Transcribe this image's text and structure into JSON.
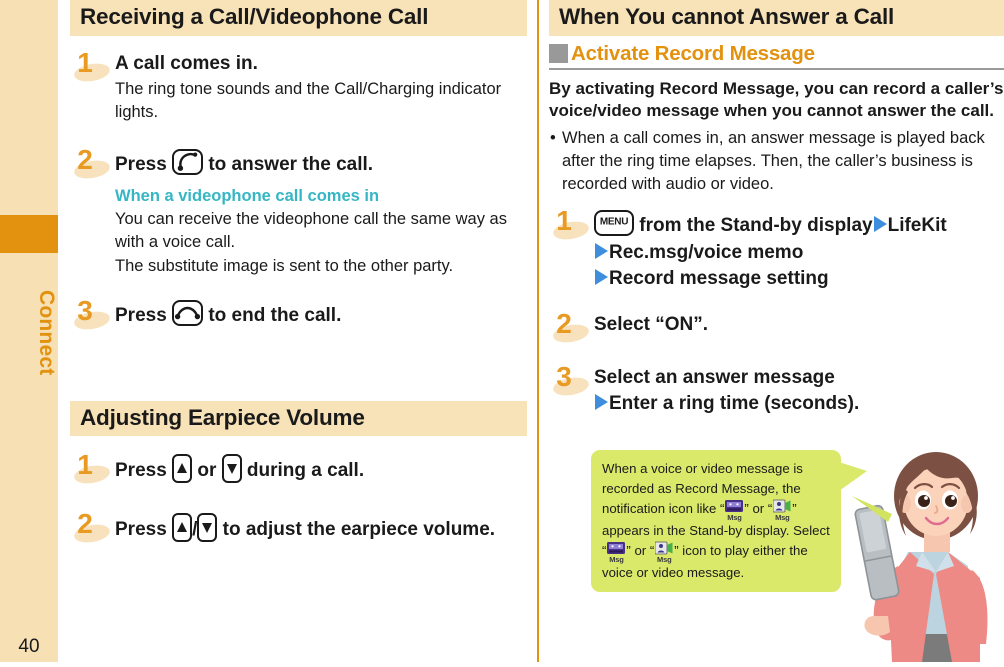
{
  "page": {
    "number": "40",
    "chapter_tab": "Connect",
    "accent_orange": "#e2920f",
    "band_beige": "#f8e2b8",
    "bubble_green": "#dbe96b",
    "teal": "#36b6c4",
    "arrow_blue": "#3f8ede"
  },
  "left_column": {
    "sections": [
      {
        "heading": "Receiving a Call/Videophone Call",
        "steps": [
          {
            "number": "1",
            "title_parts": [
              "A call comes in."
            ],
            "body": "The ring tone sounds and the Call/Charging indicator lights."
          },
          {
            "number": "2",
            "title_before": "Press",
            "key": "call-key",
            "title_after": "to answer the call.",
            "note_heading": "When a videophone call comes in",
            "body_line1": "You can receive the videophone call the same way as with a voice call.",
            "body_line2": "The substitute image is sent to the other party."
          },
          {
            "number": "3",
            "title_before": "Press",
            "key": "end-key",
            "title_after": "to end the call."
          }
        ]
      },
      {
        "heading": "Adjusting Earpiece Volume",
        "steps": [
          {
            "number": "1",
            "title_before": "Press",
            "key_up": "volume-up-key",
            "title_mid": "or",
            "key_down": "volume-down-key",
            "title_after": "during a call."
          },
          {
            "number": "2",
            "title_before": "Press",
            "key_up": "volume-up-key",
            "separator": "/",
            "key_down": "volume-down-key",
            "title_after": "to adjust the earpiece volume."
          }
        ]
      }
    ]
  },
  "right_column": {
    "heading": "When You cannot Answer a Call",
    "subheading": "Activate Record Message",
    "lead": "By activating Record Message, you can record a caller’s voice/video message when you cannot answer the call.",
    "bullets": [
      "When a call comes in, an answer message is played back after the ring time elapses. Then, the caller’s business is recorded with audio or video."
    ],
    "steps": [
      {
        "number": "1",
        "key": "menu-key",
        "key_label": "MENU",
        "line1_after_key": "from the Stand-by display",
        "line1_tail": "LifeKit",
        "line2": "Rec.msg/voice memo",
        "line3": "Record message setting"
      },
      {
        "number": "2",
        "title": "Select “ON”."
      },
      {
        "number": "3",
        "line1": "Select an answer message",
        "line2": "Enter a ring time (seconds)."
      }
    ],
    "speech_bubble": {
      "seg1": "When a voice or video message is recorded as Record Message, the notification icon like “",
      "icon1": "voice-msg-icon",
      "seg2": "” or “",
      "icon2": "video-msg-icon",
      "seg3": "” appears in the Stand-by display. Select “",
      "icon3": "voice-msg-icon",
      "seg4": "” or “",
      "icon4": "video-msg-icon",
      "seg5": "” icon to play either the voice or video message.",
      "icon_caption": "Msg"
    }
  }
}
